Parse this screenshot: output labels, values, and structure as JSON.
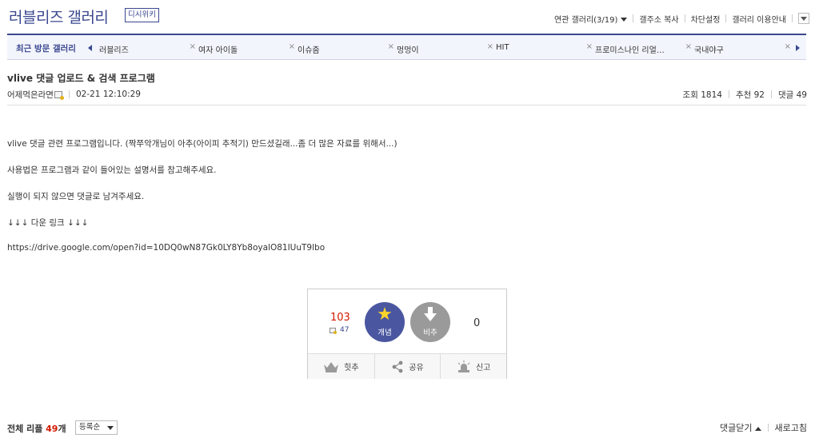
{
  "header": {
    "title": "러블리즈 갤러리",
    "badge": "디시위키",
    "links": {
      "related": "연관 갤러리(3/19)",
      "copy_address": "갤주소 복사",
      "block_settings": "차단설정",
      "guide": "갤러리 이용안내"
    }
  },
  "recent": {
    "label": "최근 방문 갤러리",
    "close_glyph": "×",
    "items": [
      {
        "label": "러블리즈"
      },
      {
        "label": "여자 아이돌"
      },
      {
        "label": "이슈줌"
      },
      {
        "label": "멍멍이"
      },
      {
        "label": "HIT"
      },
      {
        "label": "프로미스나인 리얼…"
      },
      {
        "label": "국내야구"
      }
    ]
  },
  "post": {
    "title": "vlive 댓글 업로드 & 검색 프로그램",
    "author": "어제먹은라면",
    "datetime": "02-21 12:10:29",
    "stats": {
      "views": "조회 1814",
      "recommend": "추천 92",
      "comments": "댓글 49"
    },
    "body": [
      "vlive 댓글 관련 프로그램입니다. (짝쭈악개님이 아추(아이피 추적기) 만드셨길래...좀 더 많은 자료를 위해서...)",
      "사용법은 프로그램과 같이 들어있는 설명서를 참고해주세요.",
      "실행이 되지 않으면 댓글로 남겨주세요.",
      "↓↓↓ 다운 링크 ↓↓↓",
      "https://drive.google.com/open?id=10DQ0wN87Gk0LY8Yb8oyalO81IUuT9lbo"
    ]
  },
  "recommend_box": {
    "up_count": "103",
    "fix_count": "47",
    "up_label": "개념",
    "down_label": "비추",
    "down_count": "0",
    "actions": {
      "hit": "힛추",
      "share": "공유",
      "report": "신고"
    }
  },
  "footer": {
    "total_prefix": "전체 리플 ",
    "total_count": "49",
    "total_suffix": "개",
    "sort_value": "등록순",
    "collapse": "댓글닫기",
    "refresh": "새로고침"
  },
  "colors": {
    "accent": "#3b4890",
    "up_count": "#d31900",
    "up_button": "#4a57a0",
    "down_button": "#9a9a9a"
  },
  "icons": {
    "up_button": "star-icon",
    "down_button": "down-arrow-icon",
    "hit": "crown-icon",
    "share": "share-icon",
    "report": "siren-icon"
  }
}
